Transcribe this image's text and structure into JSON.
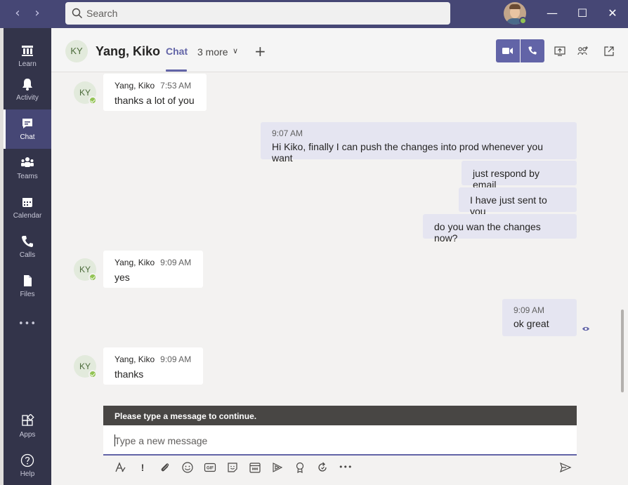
{
  "search": {
    "placeholder": "Search"
  },
  "nav": {
    "back_glyph": "‹",
    "forward_glyph": "›"
  },
  "window": {
    "minimize_glyph": "—",
    "maximize_glyph": "☐",
    "close_glyph": "✕"
  },
  "app_bar": {
    "items": [
      {
        "label": "Learn",
        "icon": "learn-icon"
      },
      {
        "label": "Activity",
        "icon": "bell-icon"
      },
      {
        "label": "Chat",
        "icon": "chat-icon",
        "active": true
      },
      {
        "label": "Teams",
        "icon": "teams-icon"
      },
      {
        "label": "Calendar",
        "icon": "calendar-icon"
      },
      {
        "label": "Calls",
        "icon": "phone-icon"
      },
      {
        "label": "Files",
        "icon": "file-icon"
      }
    ],
    "more_glyph": "•••",
    "apps_label": "Apps",
    "help_label": "Help"
  },
  "header": {
    "avatar_initials": "KY",
    "contact_name": "Yang, Kiko",
    "tab_chat": "Chat",
    "tab_more": "3 more",
    "more_chevron": "∨",
    "add_glyph": "+"
  },
  "messages": [
    {
      "direction": "in",
      "initials": "KY",
      "sender": "Yang, Kiko",
      "time": "7:53 AM",
      "text": "thanks a lot of you"
    },
    {
      "direction": "out",
      "time": "9:07 AM",
      "text": "Hi Kiko, finally I can push the changes into prod whenever you want"
    },
    {
      "direction": "out",
      "text": "just respond by email"
    },
    {
      "direction": "out",
      "text": "I have just sent to you"
    },
    {
      "direction": "out",
      "text": "do you wan the changes now?"
    },
    {
      "direction": "in",
      "initials": "KY",
      "sender": "Yang, Kiko",
      "time": "9:09 AM",
      "text": "yes"
    },
    {
      "direction": "out",
      "time": "9:09 AM",
      "text": "ok great"
    },
    {
      "direction": "in",
      "initials": "KY",
      "sender": "Yang, Kiko",
      "time": "9:09 AM",
      "text": "thanks"
    }
  ],
  "compose": {
    "warning": "Please type a message to continue.",
    "placeholder": "Type a new message",
    "tools": [
      "format-icon",
      "important-icon",
      "attach-icon",
      "emoji-icon",
      "gif-icon",
      "sticker-icon",
      "schedule-meeting-icon",
      "stream-icon",
      "praise-icon",
      "loop-icon",
      "more-options-icon",
      "send-icon"
    ],
    "more_glyph": "•••",
    "important_glyph": "!"
  },
  "colors": {
    "accent": "#6264a7",
    "titlebar": "#464775",
    "appbar": "#33344a",
    "presence": "#92c353"
  }
}
